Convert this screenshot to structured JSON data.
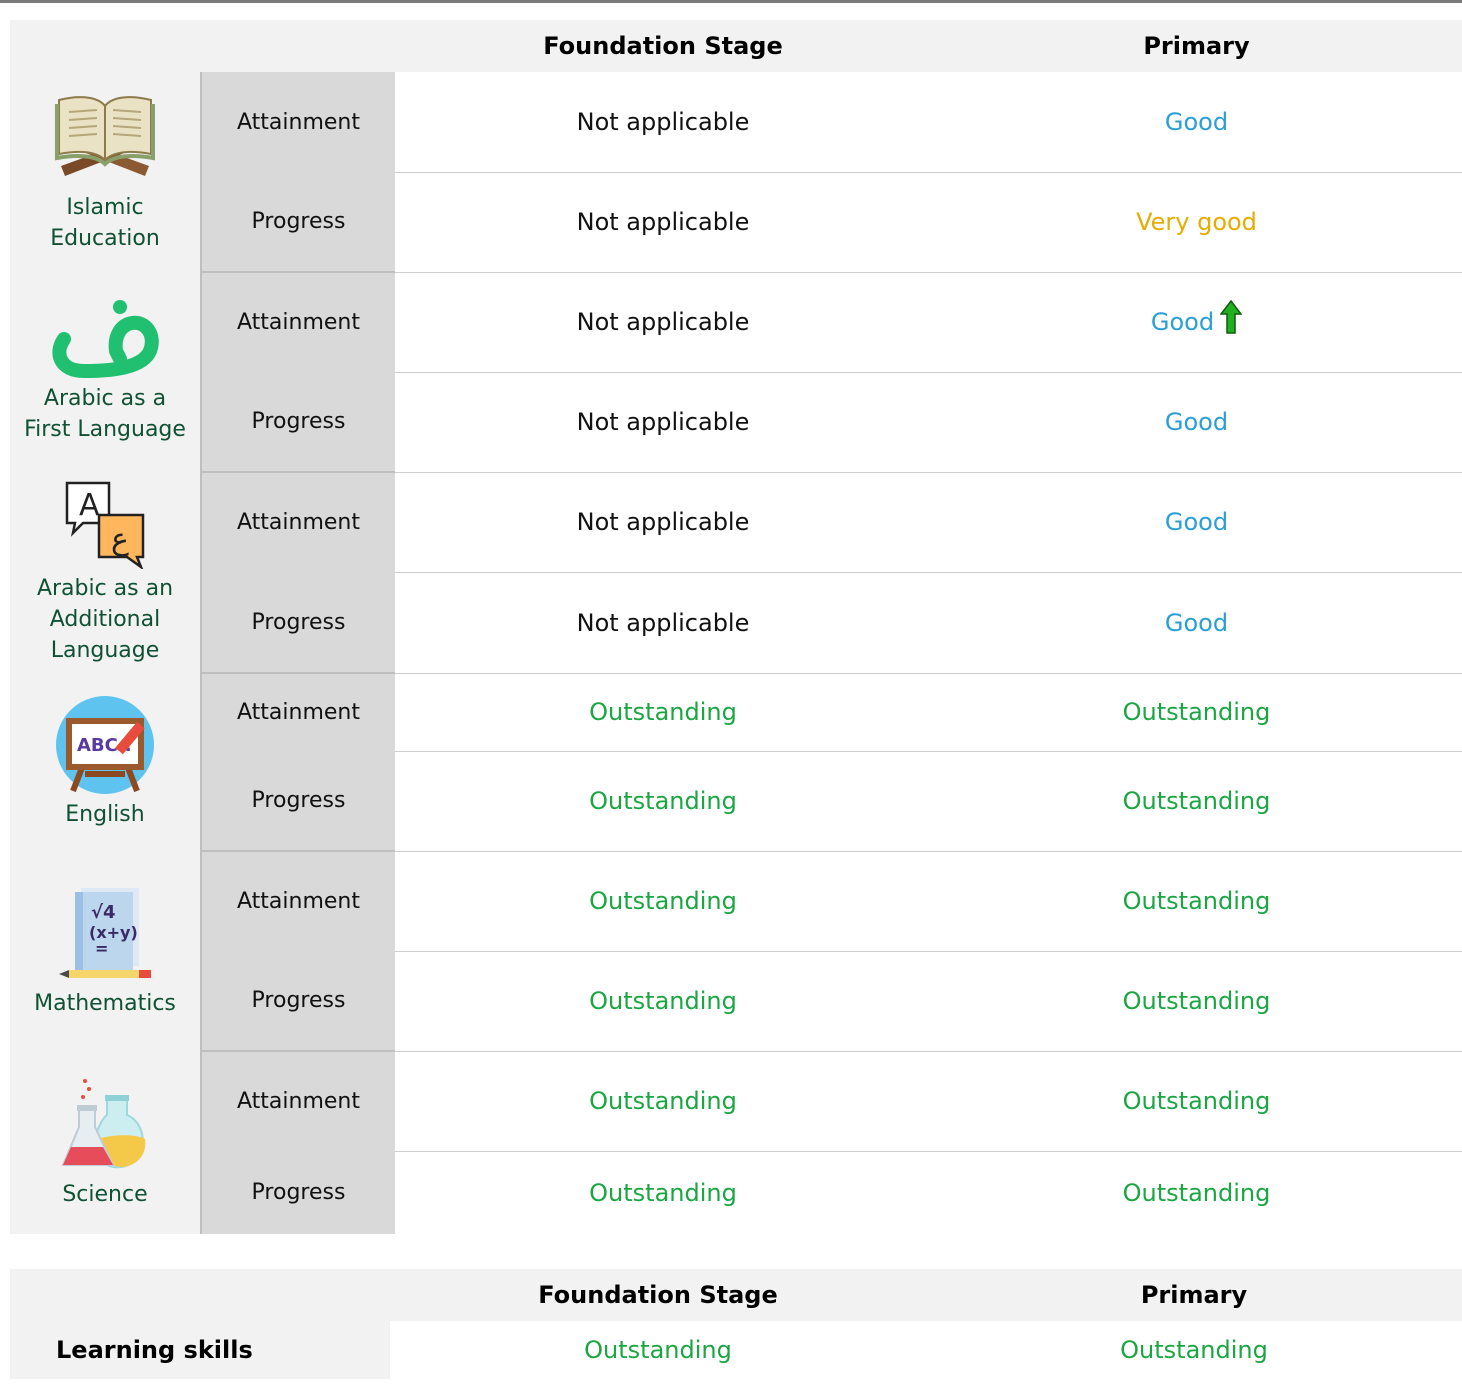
{
  "headers": {
    "col1": "Foundation Stage",
    "col2": "Primary"
  },
  "metrics": {
    "attainment": "Attainment",
    "progress": "Progress"
  },
  "subjects": [
    {
      "name_line1": "Islamic",
      "name_line2": "Education",
      "icon": "quran-book-icon",
      "attainment": [
        "Not applicable",
        "Good"
      ],
      "progress": [
        "Not applicable",
        "Very good"
      ]
    },
    {
      "name_line1": "Arabic as a",
      "name_line2": "First Language",
      "icon": "arabic-letter-dad-icon",
      "attainment": [
        "Not applicable",
        "Good"
      ],
      "progress": [
        "Not applicable",
        "Good"
      ]
    },
    {
      "name_line1": "Arabic as an",
      "name_line2": "Additional",
      "name_line3": "Language",
      "icon": "translation-speech-bubbles-icon",
      "attainment": [
        "Not applicable",
        "Good"
      ],
      "progress": [
        "Not applicable",
        "Good"
      ]
    },
    {
      "name_line1": "English",
      "icon": "abc-easel-icon",
      "attainment": [
        "Outstanding",
        "Outstanding"
      ],
      "progress": [
        "Outstanding",
        "Outstanding"
      ]
    },
    {
      "name_line1": "Mathematics",
      "icon": "math-notebook-icon",
      "attainment": [
        "Outstanding",
        "Outstanding"
      ],
      "progress": [
        "Outstanding",
        "Outstanding"
      ]
    },
    {
      "name_line1": "Science",
      "icon": "lab-flasks-icon",
      "attainment": [
        "Outstanding",
        "Outstanding"
      ],
      "progress": [
        "Outstanding",
        "Outstanding"
      ]
    }
  ],
  "improvement_indicator": {
    "subject": "Arabic as a First Language",
    "metric": "Attainment",
    "column": "Primary",
    "icon": "green-up-arrow-icon"
  },
  "skills": {
    "label": "Learning skills",
    "values": [
      "Outstanding",
      "Outstanding"
    ]
  },
  "colors": {
    "good": "#2a9fd6",
    "very_good": "#e6ac00",
    "outstanding": "#1aa641",
    "subject_text": "#0f5132"
  }
}
